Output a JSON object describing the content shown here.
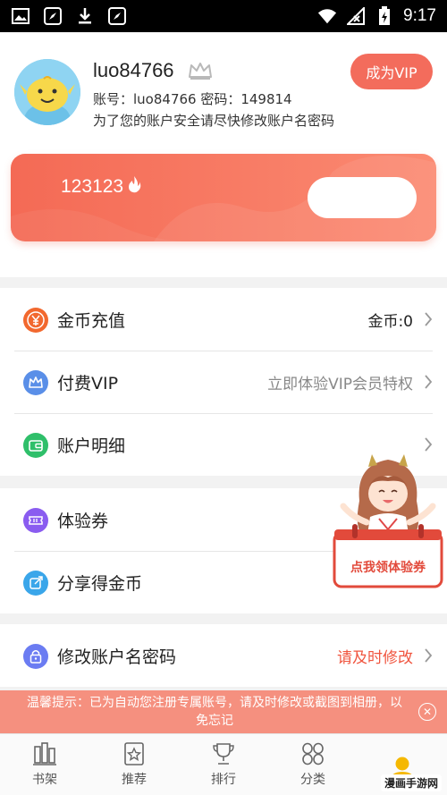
{
  "status_bar": {
    "time": "9:17",
    "left_icons": [
      "image-icon",
      "compass-icon",
      "download-icon",
      "compass-icon"
    ],
    "right_icons": [
      "wifi-icon",
      "no-signal-icon",
      "battery-icon"
    ]
  },
  "profile": {
    "username": "luo84766",
    "account_line": "账号：luo84766 密码：149814",
    "warning_line": "为了您的账户安全请尽快修改账户名密码",
    "vip_button": "成为VIP"
  },
  "coin_card": {
    "coins": "123123"
  },
  "menu_group_1": [
    {
      "label": "金币充值",
      "right": "金币:0",
      "icon": "coin-icon",
      "color": "#f2682e"
    },
    {
      "label": "付费VIP",
      "right": "立即体验VIP会员特权",
      "icon": "crown-icon",
      "color": "#5a8fe8"
    },
    {
      "label": "账户明细",
      "right": "",
      "icon": "wallet-icon",
      "color": "#2fbf6a"
    }
  ],
  "menu_group_2": [
    {
      "label": "体验券",
      "right": "",
      "icon": "ticket-icon",
      "color": "#8a5cf0"
    },
    {
      "label": "分享得金币",
      "right": "",
      "icon": "share-icon",
      "color": "#3aa6ea"
    }
  ],
  "menu_group_3": [
    {
      "label": "修改账户名密码",
      "right": "请及时修改",
      "icon": "lock-icon",
      "color": "#6b7cf2"
    }
  ],
  "mascot": {
    "banner_text": "点我领体验券"
  },
  "notice": {
    "text": "温馨提示：已为自动您注册专属账号，请及时修改或截图到相册，以免忘记"
  },
  "tabs": [
    {
      "label": "书架",
      "icon": "bookshelf-icon"
    },
    {
      "label": "推荐",
      "icon": "recommend-icon"
    },
    {
      "label": "排行",
      "icon": "trophy-icon"
    },
    {
      "label": "分类",
      "icon": "category-icon"
    },
    {
      "label": "",
      "icon": "user-icon",
      "active": true
    }
  ],
  "watermark": "漫画手游网"
}
